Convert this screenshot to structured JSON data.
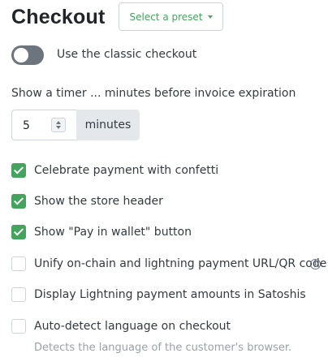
{
  "header": {
    "title": "Checkout",
    "preset_button_label": "Select a preset"
  },
  "classic_toggle": {
    "label": "Use the classic checkout",
    "enabled": false
  },
  "timer": {
    "label": "Show a timer ... minutes before invoice expiration",
    "value": "5",
    "unit": "minutes"
  },
  "options": [
    {
      "label": "Celebrate payment with confetti",
      "checked": true
    },
    {
      "label": "Show the store header",
      "checked": true
    },
    {
      "label": "Show \"Pay in wallet\" button",
      "checked": true
    },
    {
      "label": "Unify on-chain and lightning payment URL/QR code",
      "checked": false,
      "has_info_icon": true
    },
    {
      "label": "Display Lightning payment amounts in Satoshis",
      "checked": false
    },
    {
      "label": "Auto-detect language on checkout",
      "checked": false,
      "helper": "Detects the language of the customer's browser."
    }
  ],
  "colors": {
    "accent": "#44a45d",
    "toggle_off": "#6c757d",
    "text": "#343a40",
    "muted": "#9aa1a8"
  },
  "icons": {
    "preset_dropdown": "chevron-down-icon",
    "checked": "checkmark-icon",
    "info": "info-circle-icon"
  }
}
